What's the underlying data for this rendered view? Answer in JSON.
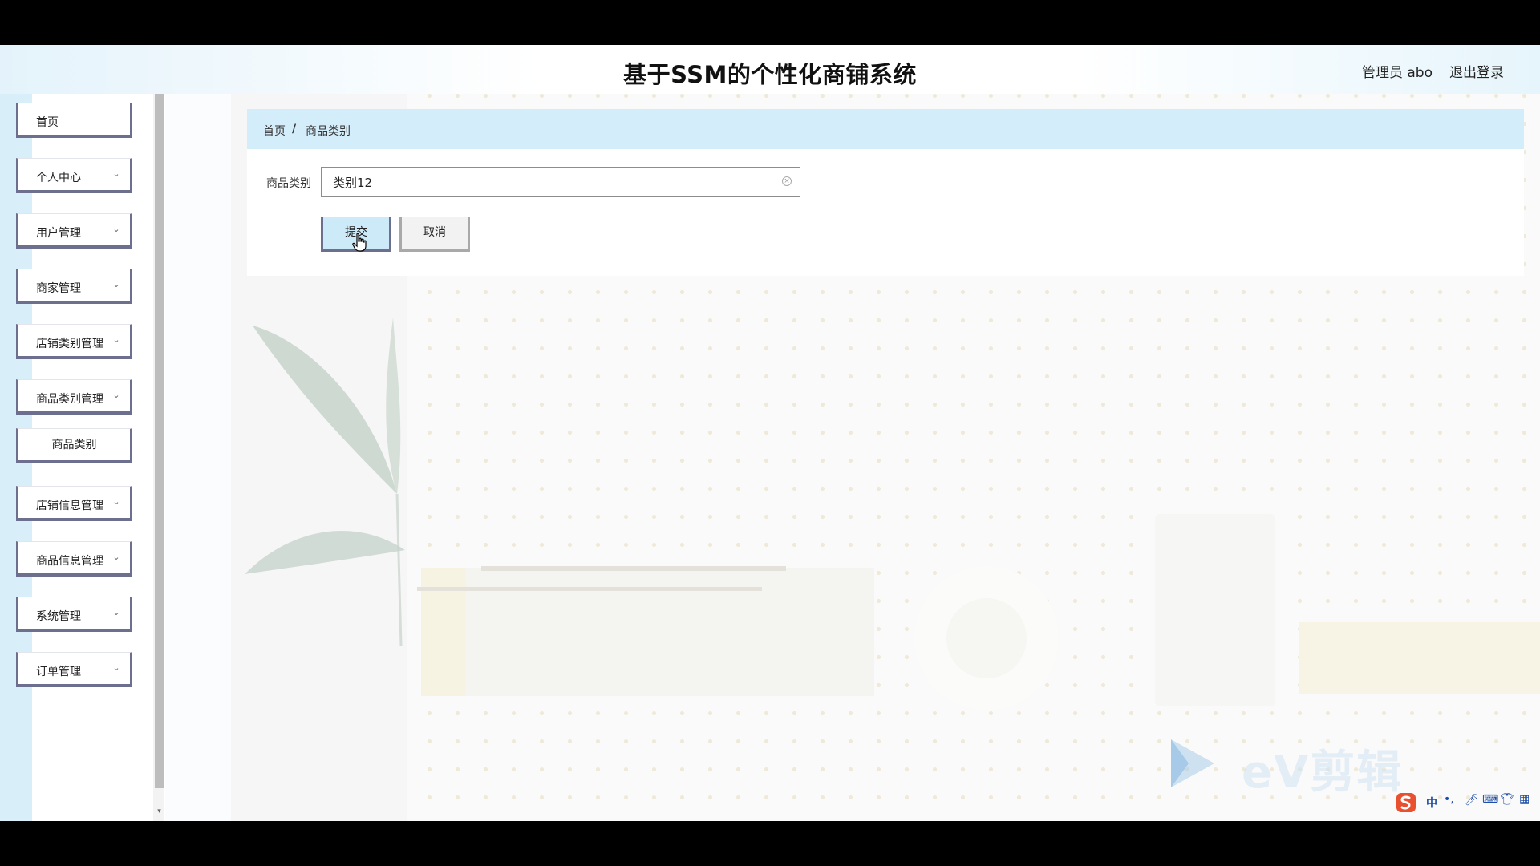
{
  "header": {
    "title": "基于SSM的个性化商铺系统",
    "user": "管理员 abo",
    "logout": "退出登录"
  },
  "sidebar": {
    "items": [
      {
        "label": "首页",
        "has_chevron": false
      },
      {
        "label": "个人中心",
        "has_chevron": true
      },
      {
        "label": "用户管理",
        "has_chevron": true
      },
      {
        "label": "商家管理",
        "has_chevron": true
      },
      {
        "label": "店铺类别管理",
        "has_chevron": true
      },
      {
        "label": "商品类别管理",
        "has_chevron": true,
        "expanded": true
      },
      {
        "label": "店铺信息管理",
        "has_chevron": true
      },
      {
        "label": "商品信息管理",
        "has_chevron": true
      },
      {
        "label": "系统管理",
        "has_chevron": true
      },
      {
        "label": "订单管理",
        "has_chevron": true
      }
    ],
    "submenu": [
      {
        "label": "商品类别"
      }
    ]
  },
  "breadcrumb": {
    "home": "首页",
    "separator": "/",
    "current": "商品类别"
  },
  "form": {
    "field_label": "商品类别",
    "field_value": "类别12",
    "submit_label": "提交",
    "cancel_label": "取消"
  },
  "watermark": {
    "text": "eV剪辑"
  },
  "ime": {
    "mode": "中",
    "punct": "•,"
  },
  "colors": {
    "breadcrumb_bg": "#d4edfa",
    "sidebar_accent": "#6d6f8f",
    "submit_bg": "#cdeaf9",
    "ime_brand": "#e8502f"
  }
}
